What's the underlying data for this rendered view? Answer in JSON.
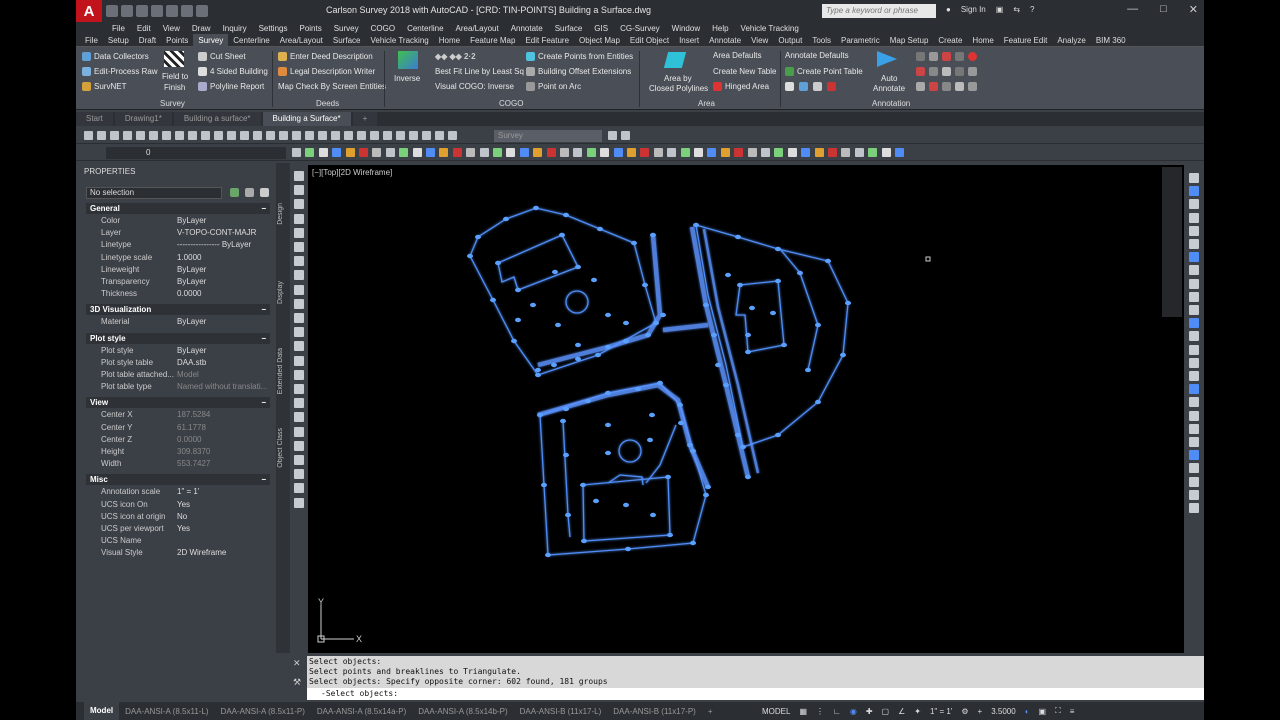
{
  "title": "Carlson Survey 2018 with AutoCAD - [CRD: TIN-POINTS]     Building a Surface.dwg",
  "app_logo": "A",
  "search_placeholder": "Type a keyword or phrase",
  "sign_in": "Sign In",
  "menu": [
    "File",
    "Edit",
    "View",
    "Draw",
    "Inquiry",
    "Settings",
    "Points",
    "Survey",
    "COGO",
    "Centerline",
    "Area/Layout",
    "Annotate",
    "Surface",
    "GIS",
    "CG-Survey",
    "Window",
    "Help",
    "Vehicle Tracking"
  ],
  "ribbon_tabs": [
    "File",
    "Setup",
    "Draft",
    "Points",
    "Survey",
    "Centerline",
    "Area/Layout",
    "Surface",
    "Vehicle Tracking",
    "Home",
    "Feature Map",
    "Edit Feature",
    "Object Map",
    "Edit Object",
    "Insert",
    "Annotate",
    "View",
    "Output",
    "Tools",
    "Parametric",
    "Map Setup",
    "Create",
    "Home",
    "Feature Edit",
    "Analyze",
    "BIM 360"
  ],
  "ribbon_active": "Survey",
  "ribbon": {
    "data_collectors": "Data Collectors",
    "edit_process_raw": "Edit-Process Raw",
    "survnet": "SurvNET",
    "field_to_finish_1": "Field to",
    "field_to_finish_2": "Finish",
    "cut_sheet": "Cut Sheet",
    "four_sided_building": "4 Sided Building",
    "polyline_report": "Polyline Report",
    "survey_group": "Survey",
    "enter_deed": "Enter Deed Description",
    "legal_writer": "Legal Description Writer",
    "map_check": "Map Check By Screen Entities",
    "deeds_group": "Deeds",
    "inverse": "Inverse",
    "best_fit": "Best Fit Line by Least Sq",
    "visual_cogo": "Visual COGO: Inverse",
    "create_points": "Create Points from Entities",
    "building_offset": "Building Offset Extensions",
    "point_on_arc": "Point on Arc",
    "cogo_group": "COGO",
    "area_by_1": "Area by",
    "area_by_2": "Closed Polylines",
    "area_defaults": "Area Defaults",
    "create_new_table": "Create New Table",
    "hinged_area": "Hinged Area",
    "area_group": "Area",
    "annotate_defaults": "Annotate Defaults",
    "create_point_table": "Create Point Table",
    "auto_annotate_1": "Auto",
    "auto_annotate_2": "Annotate",
    "annotation_group": "Annotation"
  },
  "doc_tabs": [
    "Start",
    "Drawing1*",
    "Building a surface*",
    "Building a Surface*"
  ],
  "doc_tab_active": "Building a Surface*",
  "survey_combo": "Survey",
  "layer_combo": "0",
  "properties": {
    "title": "PROPERTIES",
    "selection": "No selection",
    "sections": [
      {
        "name": "General",
        "rows": [
          [
            "Color",
            "ByLayer"
          ],
          [
            "Layer",
            "V-TOPO-CONT-MAJR"
          ],
          [
            "Linetype",
            "---------------- ByLayer"
          ],
          [
            "Linetype scale",
            "1.0000"
          ],
          [
            "Lineweight",
            "ByLayer"
          ],
          [
            "Transparency",
            "ByLayer"
          ],
          [
            "Thickness",
            "0.0000"
          ]
        ]
      },
      {
        "name": "3D Visualization",
        "rows": [
          [
            "Material",
            "ByLayer"
          ]
        ]
      },
      {
        "name": "Plot style",
        "rows": [
          [
            "Plot style",
            "ByLayer"
          ],
          [
            "Plot style table",
            "DAA.stb"
          ],
          [
            "Plot table attached...",
            "Model"
          ],
          [
            "Plot table type",
            "Named without translati..."
          ]
        ]
      },
      {
        "name": "View",
        "rows": [
          [
            "Center X",
            "187.5284"
          ],
          [
            "Center Y",
            "61.1778"
          ],
          [
            "Center Z",
            "0.0000"
          ],
          [
            "Height",
            "309.8370"
          ],
          [
            "Width",
            "553.7427"
          ]
        ]
      },
      {
        "name": "Misc",
        "rows": [
          [
            "Annotation scale",
            "1\" = 1'"
          ],
          [
            "UCS icon On",
            "Yes"
          ],
          [
            "UCS icon at origin",
            "No"
          ],
          [
            "UCS per viewport",
            "Yes"
          ],
          [
            "UCS Name",
            ""
          ],
          [
            "Visual Style",
            "2D Wireframe"
          ]
        ]
      }
    ]
  },
  "palette_tabs": [
    "Design",
    "Display",
    "Extended Data",
    "Object Class"
  ],
  "viewport_label": "[−][Top][2D Wireframe]",
  "ucs_x": "X",
  "ucs_y": "Y",
  "command_history": [
    "Select objects:",
    "Select points and breaklines to Triangulate.",
    "Select objects: Specify opposite corner: 602 found, 181 groups"
  ],
  "command_prompt": "-Select objects:",
  "layout_tabs": [
    "Model",
    "DAA-ANSI-A (8.5x11-L)",
    "DAA-ANSI-A (8.5x11-P)",
    "DAA-ANSI-A (8.5x14a-P)",
    "DAA-ANSI-A (8.5x14b-P)",
    "DAA-ANSI-B (11x17-L)",
    "DAA-ANSI-B (11x17-P)"
  ],
  "layout_active": "Model",
  "status_model": "MODEL",
  "status_scale": "1\" = 1'",
  "status_value": "3.5000",
  "colors": {
    "accent": "#4f8cf5",
    "background": "#000000",
    "panel": "#3b3f46"
  }
}
